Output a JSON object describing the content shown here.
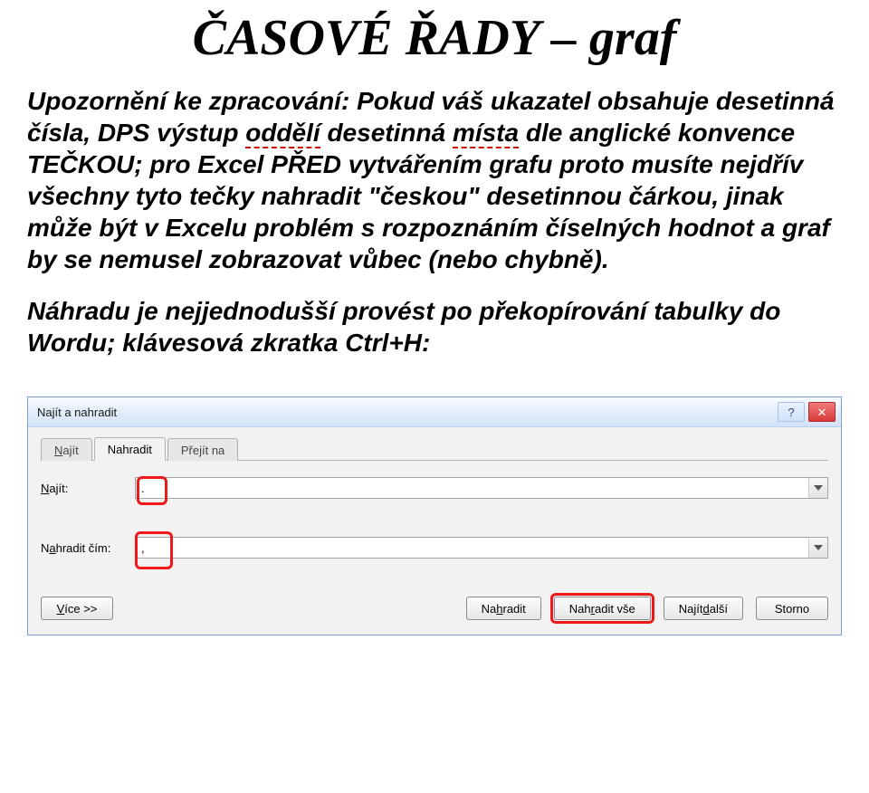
{
  "title": "ČASOVÉ ŘADY – graf",
  "para1": "Upozornění ke zpracování: Pokud váš ukazatel obsahuje desetinná čísla, DPS výstup oddělí desetinná místa dle anglické konvence TEČKOU; pro Excel PŘED vytvářením grafu proto musíte nejdřív všechny tyto tečky nahradit \"českou\" desetinnou čárkou, jinak může být v Excelu problém s rozpoznáním číselných hodnot a graf by se nemusel zobrazovat vůbec (nebo chybně).",
  "para2": "Náhradu je nejjednodušší provést po překopírování tabulky do Wordu; klávesová zkratka Ctrl+H:",
  "dialog": {
    "title": "Najít a nahradit",
    "help_symbol": "?",
    "close_symbol": "✕",
    "tabs": {
      "find": "Najít",
      "replace": "Nahradit",
      "goto": "Přejít na"
    },
    "find_label": "Najít:",
    "find_value": ".",
    "replace_label": "Nahradit čím:",
    "replace_value": ",",
    "buttons": {
      "more": "Více >>",
      "replace": "Nahradit",
      "replace_all": "Nahradit vše",
      "find_next": "Najít další",
      "cancel": "Storno"
    }
  }
}
